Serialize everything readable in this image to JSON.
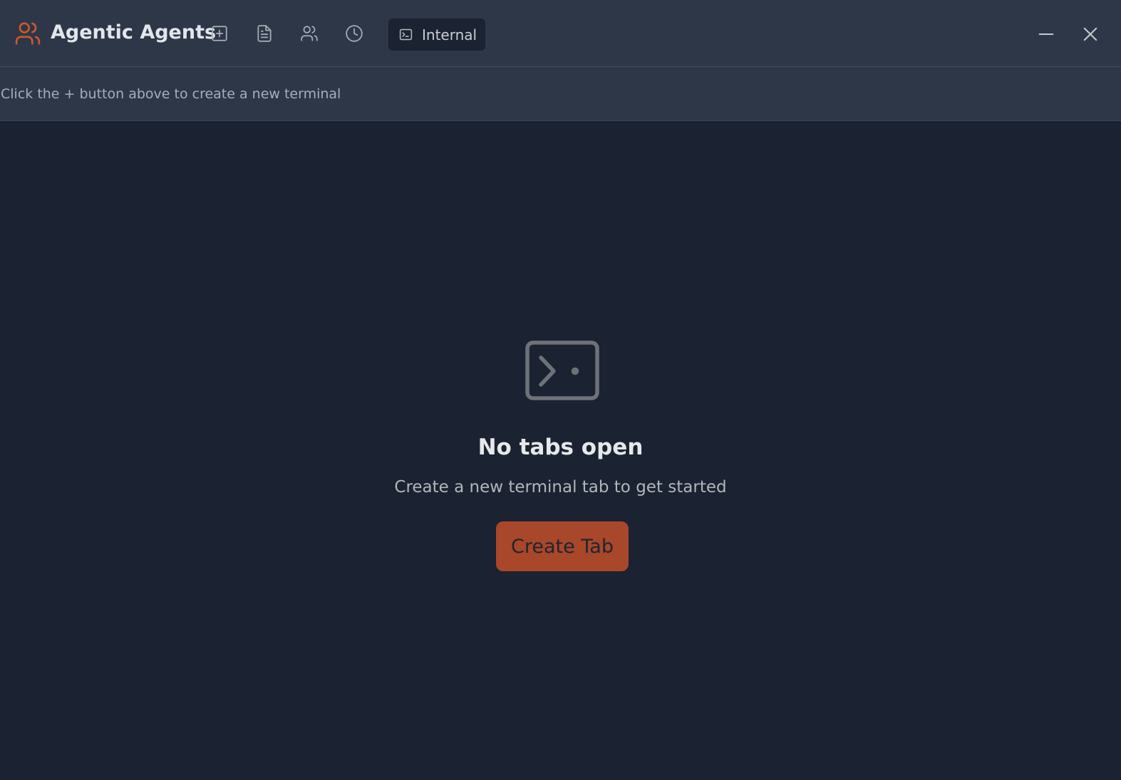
{
  "app": {
    "title": "Agentic Agents",
    "brand_icon": "users-icon",
    "accent_color": "#c9582f"
  },
  "toolbar": {
    "buttons": [
      {
        "icon": "plus-square-icon",
        "label": "New"
      },
      {
        "icon": "file-text-icon",
        "label": "Documents"
      },
      {
        "icon": "users-icon",
        "label": "Agents"
      },
      {
        "icon": "clock-icon",
        "label": "History"
      }
    ],
    "mode": {
      "icon": "terminal-icon",
      "label": "Internal"
    }
  },
  "window_controls": {
    "minimize_icon": "minimize-icon",
    "close_icon": "close-icon"
  },
  "hint": {
    "text": "Click the + button above to create a new terminal"
  },
  "empty_state": {
    "icon": "terminal-icon",
    "title": "No tabs open",
    "subtitle": "Create a new terminal tab to get started",
    "button_label": "Create Tab",
    "button_color": "#a8472a"
  }
}
